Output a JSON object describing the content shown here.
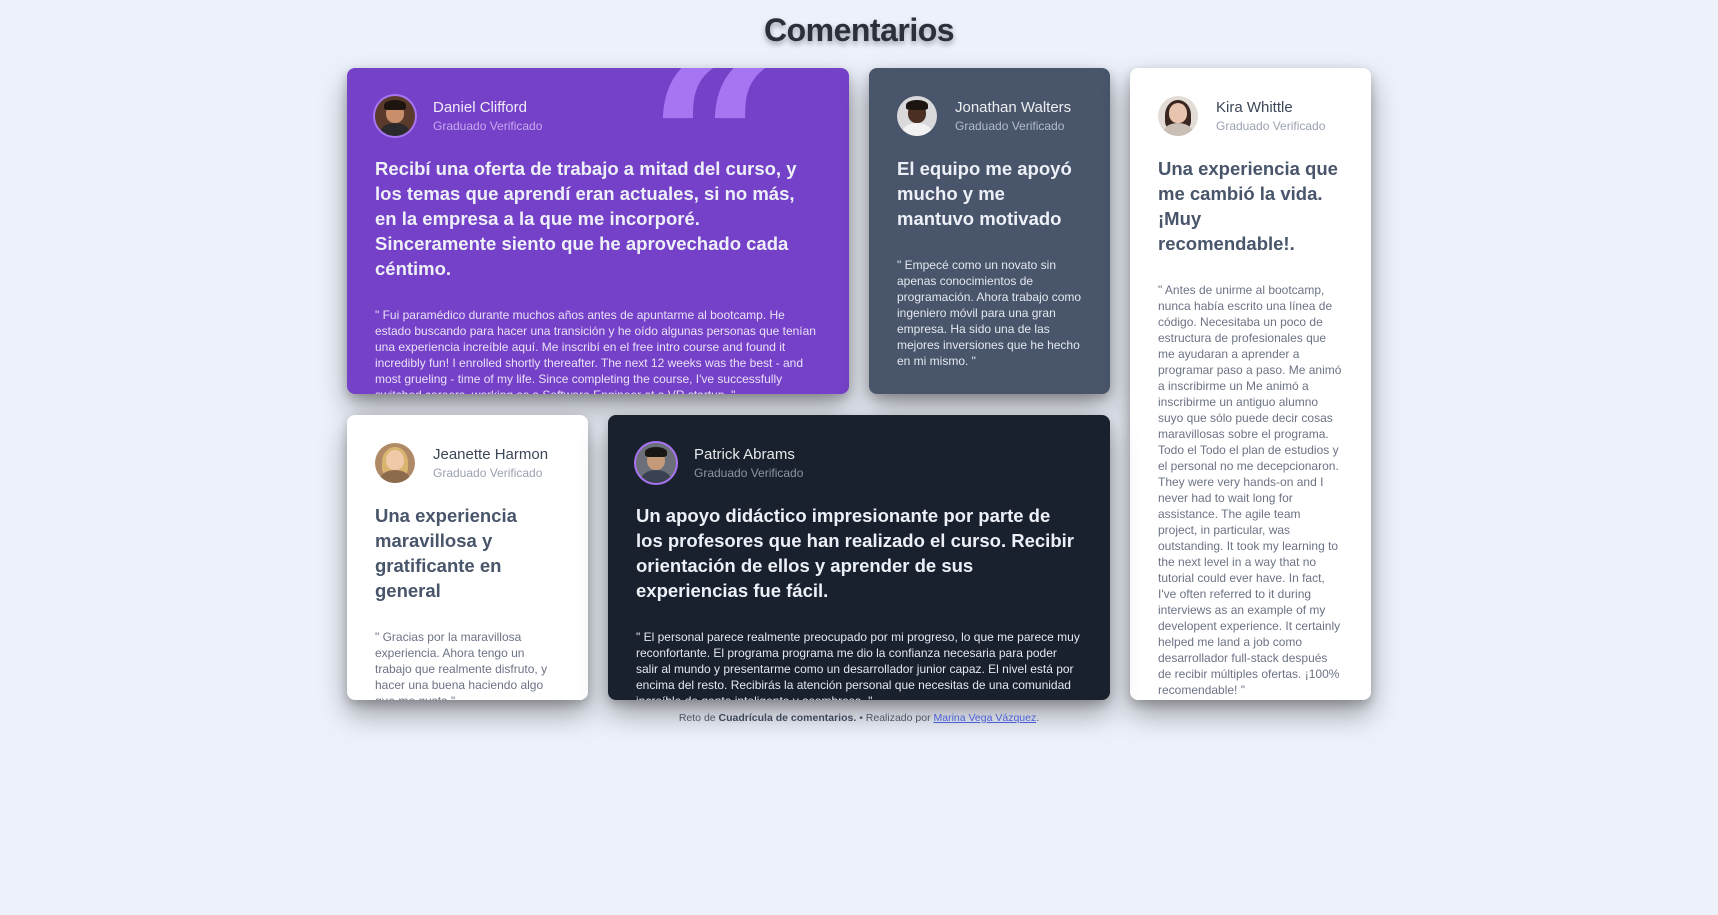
{
  "page": {
    "title": "Comentarios"
  },
  "testimonials": [
    {
      "name": "Daniel Clifford",
      "role": "Graduado Verificado",
      "headline": "Recibí una oferta de trabajo a mitad del curso, y los temas que aprendí eran actuales, si no más, en la empresa a la que me incorporé. Sinceramente siento que he aprovechado cada céntimo.",
      "quote": "\" Fui paramédico durante muchos años antes de apuntarme al bootcamp. He estado buscando para hacer una transición y he oído algunas personas que tenían una experiencia increíble aquí. Me inscribí en el free intro course and found it incredibly fun! I enrolled shortly thereafter. The next 12 weeks was the best - and most grueling - time of my life. Since completing the course, I've successfully switched careers, working as a Software Engineer at a VR startup. \""
    },
    {
      "name": "Jonathan Walters",
      "role": "Graduado Verificado",
      "headline": "El equipo me apoyó mucho y me mantuvo motivado",
      "quote": "\" Empecé como un novato sin apenas conocimientos de programación. Ahora trabajo como ingeniero móvil para una gran empresa. Ha sido una de las mejores inversiones que he hecho en mi mismo. \""
    },
    {
      "name": "Kira Whittle",
      "role": "Graduado Verificado",
      "headline": "Una experiencia que me cambió la vida. ¡Muy recomendable!.",
      "quote": "\" Antes de unirme al bootcamp, nunca había escrito una línea de código. Necesitaba un poco de estructura de profesionales que me ayudaran a aprender a programar paso a paso. Me animó a inscribirme un Me animó a inscribirme un antiguo alumno suyo que sólo puede decir cosas maravillosas sobre el programa. Todo el Todo el plan de estudios y el personal no me decepcionaron. They were very hands-on and I never had to wait long for assistance. The agile team project, in particular, was outstanding. It took my learning to the next level in a way that no tutorial could ever have. In fact, I've often referred to it during interviews as an example of my developent experience. It certainly helped me land a job como desarrollador full-stack después de recibir múltiples ofertas. ¡100% recomendable! \""
    },
    {
      "name": "Jeanette Harmon",
      "role": "Graduado Verificado",
      "headline": "Una experiencia maravillosa y gratificante en general",
      "quote": "\" Gracias por la maravillosa experiencia. Ahora tengo un trabajo que realmente disfruto, y hacer una buena haciendo algo que me gusta.\""
    },
    {
      "name": "Patrick Abrams",
      "role": "Graduado Verificado",
      "headline": "Un apoyo didáctico impresionante por parte de los profesores que han realizado el curso. Recibir orientación de ellos y aprender de sus experiencias fue fácil.",
      "quote": "\" El personal parece realmente preocupado por mi progreso, lo que me parece muy reconfortante. El programa programa me dio la confianza necesaria para poder salir al mundo y presentarme como un desarrollador junior capaz. El nivel está por encima del resto. Recibirás la atención personal que necesitas de una comunidad increíble de gente inteligente y asombrosa. \""
    }
  ],
  "decor": {
    "quote_glyph": "“"
  },
  "footer": {
    "prefix": "Reto de",
    "challenge": "Cuadrícula de comentarios.",
    "middle": "• Realizado por",
    "author": "Marina Vega Vázquez",
    "suffix": "."
  },
  "colors": {
    "background": "#edf1fa",
    "purple": "#7541c8",
    "slate": "#48556a",
    "dark": "#19212e",
    "white": "#ffffff",
    "accent": "#a775f1"
  }
}
